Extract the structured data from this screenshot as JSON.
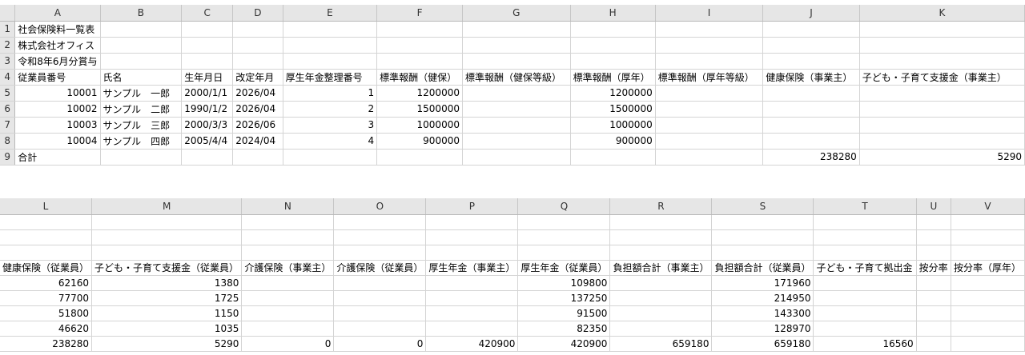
{
  "top": {
    "columns": [
      "A",
      "B",
      "C",
      "D",
      "E",
      "F",
      "G",
      "H",
      "I",
      "J",
      "K"
    ],
    "rows": [
      {
        "n": "1",
        "cells": [
          "社会保険料一覧表",
          "",
          "",
          "",
          "",
          "",
          "",
          "",
          "",
          "",
          ""
        ]
      },
      {
        "n": "2",
        "cells": [
          "株式会社オフィス",
          "",
          "",
          "",
          "",
          "",
          "",
          "",
          "",
          "",
          ""
        ]
      },
      {
        "n": "3",
        "cells": [
          "令和8年6月分賞与",
          "",
          "",
          "",
          "",
          "",
          "",
          "",
          "",
          "",
          ""
        ]
      },
      {
        "n": "4",
        "cells": [
          "従業員番号",
          "氏名",
          "生年月日",
          "改定年月",
          "厚生年金整理番号",
          "標準報酬（健保）",
          "標準報酬（健保等級）",
          "標準報酬（厚年）",
          "標準報酬（厚年等級）",
          "健康保険（事業主）",
          "子ども・子育て支援金（事業主）"
        ]
      },
      {
        "n": "5",
        "cells": [
          "10001",
          "サンプル　一郎",
          "2000/1/1",
          "2026/04",
          "1",
          "1200000",
          "",
          "1200000",
          "",
          "",
          ""
        ]
      },
      {
        "n": "6",
        "cells": [
          "10002",
          "サンプル　二郎",
          "1990/1/2",
          "2026/04",
          "2",
          "1500000",
          "",
          "1500000",
          "",
          "",
          ""
        ]
      },
      {
        "n": "7",
        "cells": [
          "10003",
          "サンプル　三郎",
          "2000/3/3",
          "2026/06",
          "3",
          "1000000",
          "",
          "1000000",
          "",
          "",
          ""
        ]
      },
      {
        "n": "8",
        "cells": [
          "10004",
          "サンプル　四郎",
          "2005/4/4",
          "2024/04",
          "4",
          "900000",
          "",
          "900000",
          "",
          "",
          ""
        ]
      },
      {
        "n": "9",
        "cells": [
          "合計",
          "",
          "",
          "",
          "",
          "",
          "",
          "",
          "",
          "238280",
          "5290"
        ]
      }
    ]
  },
  "bottom": {
    "columns": [
      "L",
      "M",
      "N",
      "O",
      "P",
      "Q",
      "R",
      "S",
      "T",
      "U",
      "V"
    ],
    "rows": [
      {
        "cells": [
          "",
          "",
          "",
          "",
          "",
          "",
          "",
          "",
          "",
          "",
          ""
        ]
      },
      {
        "cells": [
          "",
          "",
          "",
          "",
          "",
          "",
          "",
          "",
          "",
          "",
          ""
        ]
      },
      {
        "cells": [
          "",
          "",
          "",
          "",
          "",
          "",
          "",
          "",
          "",
          "",
          ""
        ]
      },
      {
        "cells": [
          "健康保険（従業員）",
          "子ども・子育て支援金（従業員）",
          "介護保険（事業主）",
          "介護保険（従業員）",
          "厚生年金（事業主）",
          "厚生年金（従業員）",
          "負担額合計（事業主）",
          "負担額合計（従業員）",
          "子ども・子育て拠出金",
          "按分率",
          "按分率（厚年）"
        ]
      },
      {
        "cells": [
          "62160",
          "1380",
          "",
          "",
          "",
          "109800",
          "",
          "171960",
          "",
          "",
          ""
        ]
      },
      {
        "cells": [
          "77700",
          "1725",
          "",
          "",
          "",
          "137250",
          "",
          "214950",
          "",
          "",
          ""
        ]
      },
      {
        "cells": [
          "51800",
          "1150",
          "",
          "",
          "",
          "91500",
          "",
          "143300",
          "",
          "",
          ""
        ]
      },
      {
        "cells": [
          "46620",
          "1035",
          "",
          "",
          "",
          "82350",
          "",
          "128970",
          "",
          "",
          ""
        ]
      },
      {
        "cells": [
          "238280",
          "5290",
          "0",
          "0",
          "420900",
          "420900",
          "659180",
          "659180",
          "16560",
          "",
          ""
        ]
      }
    ]
  }
}
